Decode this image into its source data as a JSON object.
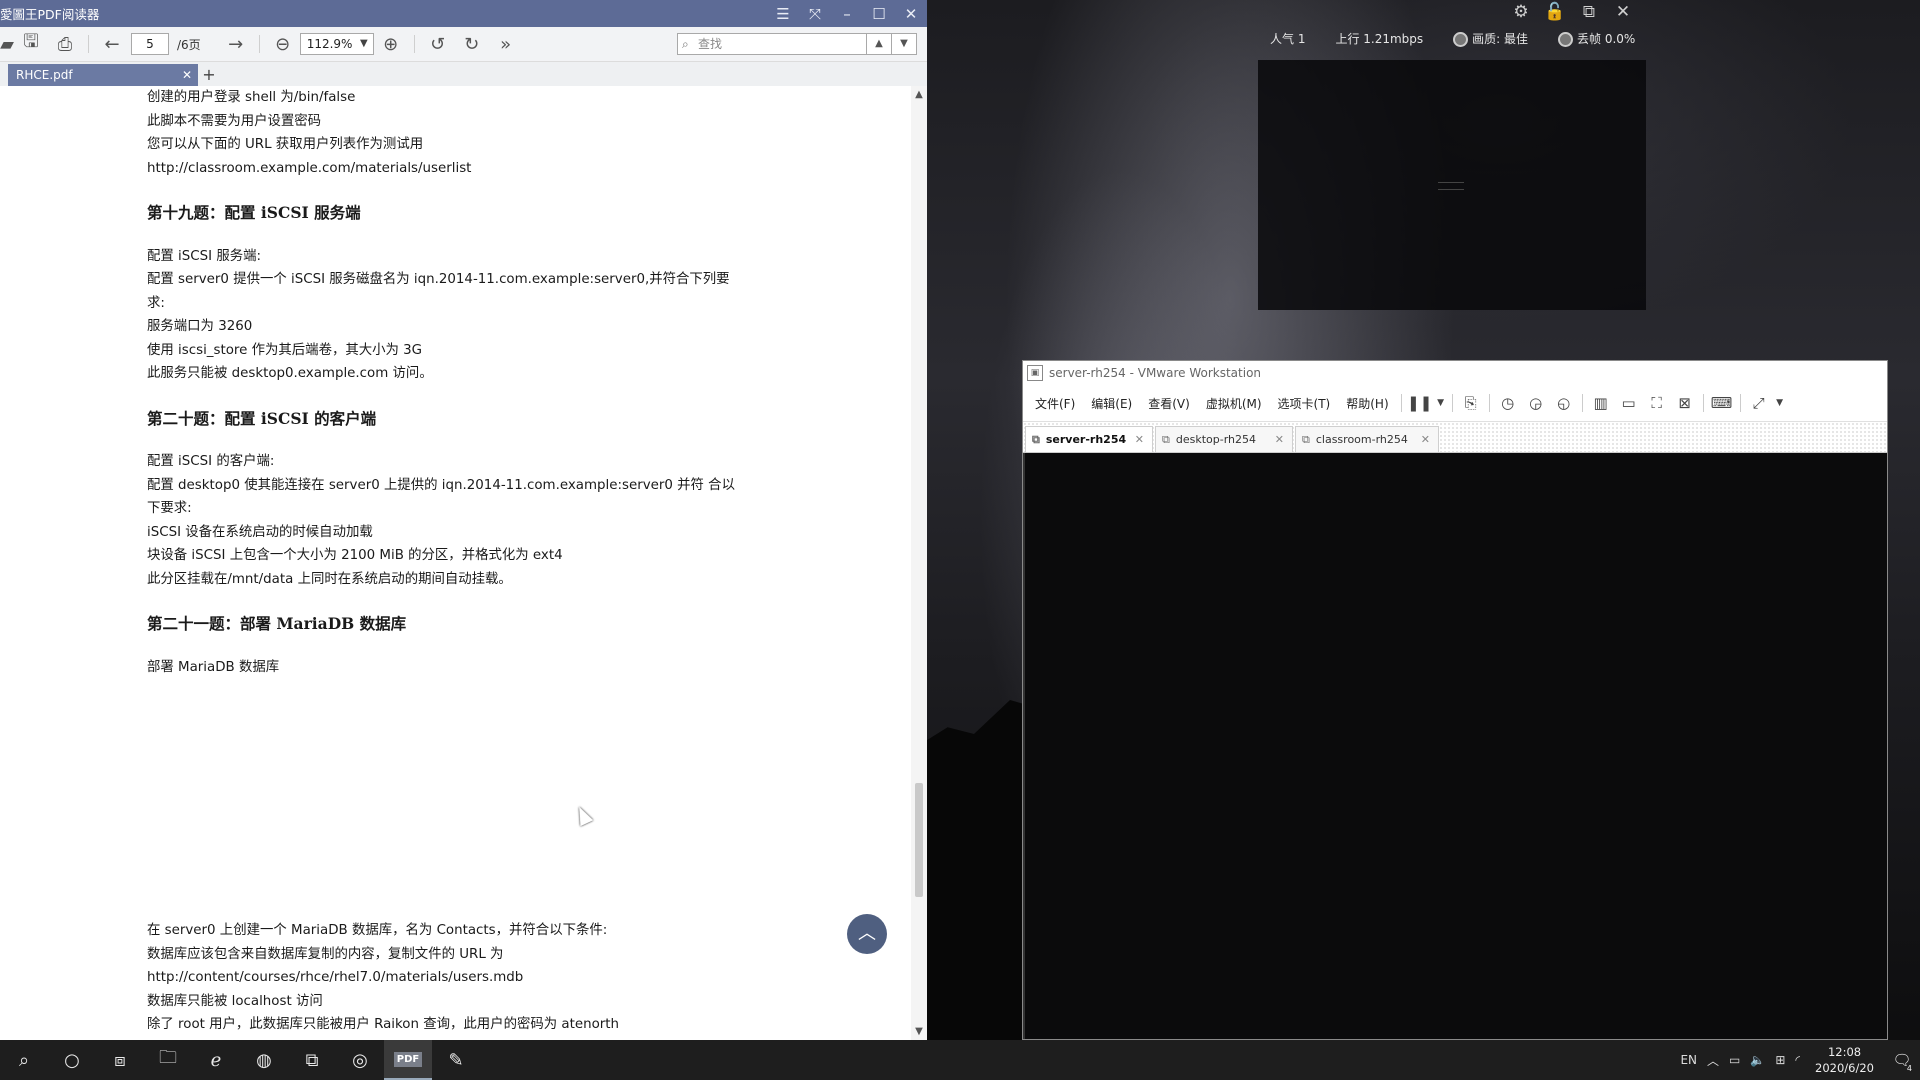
{
  "desktop": {
    "stream": {
      "viewers": "人气  1",
      "upload": "上行  1.21mbps",
      "quality": "画质: 最佳",
      "loss": "丢帧  0.0%"
    }
  },
  "pdf": {
    "title": "愛圖王PDF阅读器",
    "toolbar": {
      "page": "5",
      "page_total": "/6页",
      "zoom": "112.9%",
      "search_placeholder": "查找"
    },
    "tab": "RHCE.pdf",
    "lines": {
      "l1": "创建的用户登录 shell 为/bin/false",
      "l2": "此脚本不需要为用户设置密码",
      "l3": "您可以从下面的 URL 获取用户列表作为测试用",
      "l4": "http://classroom.example.com/materials/userlist",
      "h19": "第十九题：配置 iSCSI 服务端",
      "q19_1": "配置 iSCSI 服务端:",
      "q19_2": "配置 server0 提供一个 iSCSI 服务磁盘名为 iqn.2014-11.com.example:server0,并符合下列要",
      "q19_3": "求:",
      "q19_4": "服务端口为 3260",
      "q19_5": "使用 iscsi_store 作为其后端卷，其大小为 3G",
      "q19_6": "此服务只能被 desktop0.example.com 访问。",
      "h20": "第二十题：配置 iSCSI 的客户端",
      "q20_1": "配置 iSCSI 的客户端:",
      "q20_2": "配置 desktop0 使其能连接在 server0 上提供的 iqn.2014-11.com.example:server0 并符  合以",
      "q20_3": "下要求:",
      "q20_4": "iSCSI 设备在系统启动的时候自动加载",
      "q20_5": "块设备 iSCSI 上包含一个大小为 2100 MiB 的分区，并格式化为 ext4",
      "q20_6": "此分区挂载在/mnt/data 上同时在系统启动的期间自动挂载。",
      "h21": "第二十一题：部署 MariaDB 数据库",
      "q21_1": "部署 MariaDB 数据库",
      "q21_2": "在  server0  上创建一个  MariaDB  数据库，名为  Contacts，并符合以下条件:",
      "q21_3": "数据库应该包含来自数据库复制的内容，复制文件的 URL 为",
      "q21_4": "http://content/courses/rhce/rhel7.0/materials/users.mdb",
      "q21_5": "数据库只能被  localhost  访问",
      "q21_6": "除了  root  用户，此数据库只能被用户  Raikon  查询，此用户的密码为  atenorth"
    }
  },
  "vmware": {
    "title": "server-rh254 - VMware Workstation",
    "menus": {
      "file": "文件(F)",
      "edit": "编辑(E)",
      "view": "查看(V)",
      "vm": "虚拟机(M)",
      "tabs": "选项卡(T)",
      "help": "帮助(H)"
    },
    "tabs": {
      "t1": "server-rh254",
      "t2": "desktop-rh254",
      "t3": "classroom-rh254"
    }
  },
  "taskbar": {
    "lang": "EN",
    "time": "12:08",
    "date": "2020/6/20",
    "notif_count": "4"
  }
}
